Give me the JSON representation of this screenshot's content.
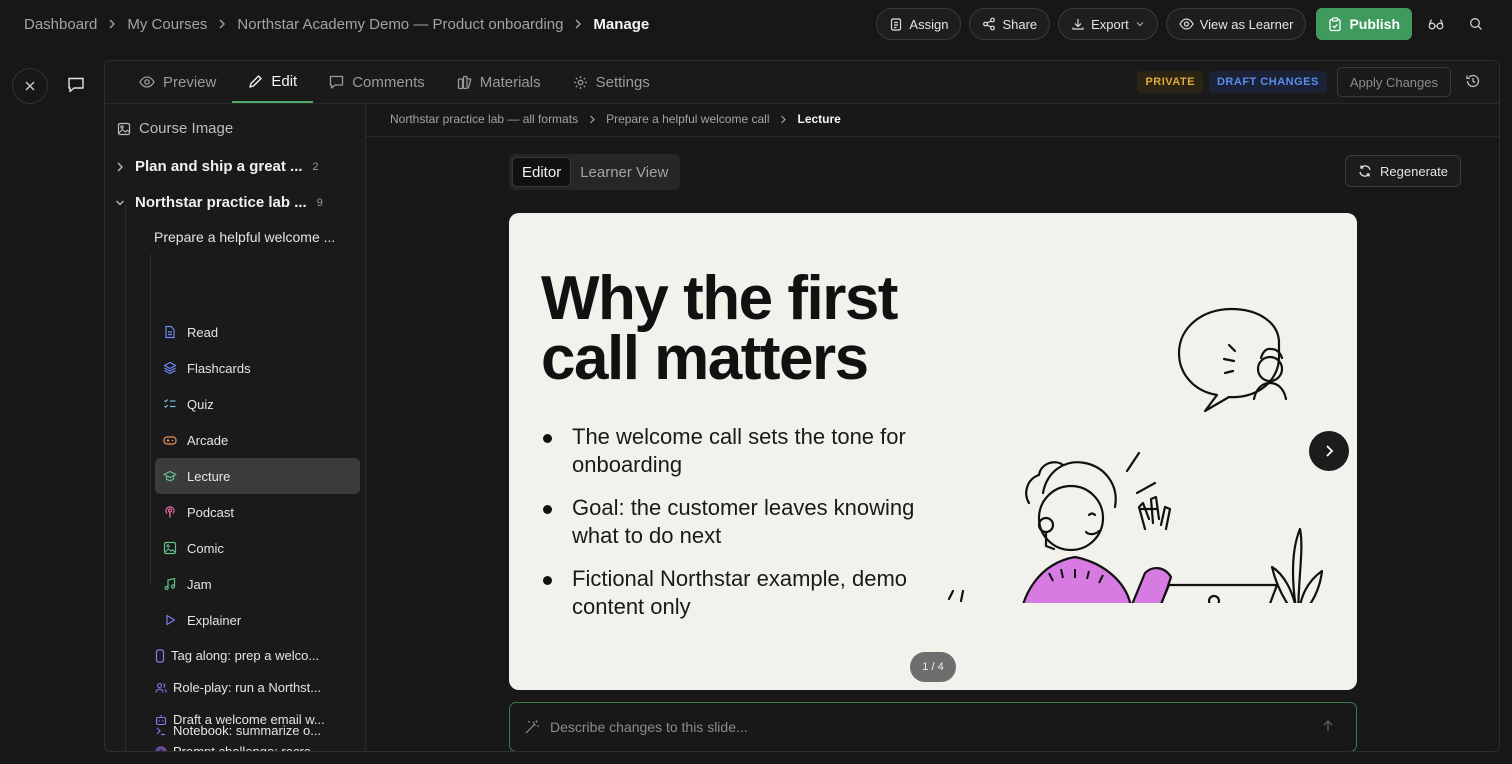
{
  "breadcrumb": {
    "items": [
      "Dashboard",
      "My Courses",
      "Northstar Academy Demo — Product onboarding"
    ],
    "current": "Manage"
  },
  "top_actions": {
    "assign": "Assign",
    "share": "Share",
    "export": "Export",
    "view_as_learner": "View as Learner",
    "publish": "Publish"
  },
  "tabs": [
    "Preview",
    "Edit",
    "Comments",
    "Materials",
    "Settings"
  ],
  "active_tab": "Edit",
  "status": {
    "private": "PRIVATE",
    "draft": "DRAFT CHANGES",
    "apply": "Apply Changes"
  },
  "sidebar": {
    "course_image": "Course Image",
    "sections": [
      {
        "title": "Plan and ship a great ...",
        "count": "2"
      },
      {
        "title": "Northstar practice lab ...",
        "count": "9"
      }
    ],
    "lesson": "Prepare a helpful welcome ...",
    "items": [
      "Read",
      "Flashcards",
      "Quiz",
      "Arcade",
      "Lecture",
      "Podcast",
      "Comic",
      "Jam",
      "Explainer"
    ],
    "active_item": "Lecture",
    "sub_lessons": [
      "Tag along: prep a welco...",
      "Role-play: run a Northst...",
      "Draft a welcome email w...",
      "Prompt challenge: recre...",
      "Notebook: summarize o..."
    ]
  },
  "content": {
    "crumbs": [
      "Northstar practice lab — all formats",
      "Prepare a helpful welcome call"
    ],
    "crumb_current": "Lecture",
    "view_toggle": [
      "Editor",
      "Learner View"
    ],
    "regenerate": "Regenerate",
    "slide": {
      "title": "Why the first call matters",
      "bullets": [
        "The welcome call sets the tone for onboarding",
        "Goal: the customer leaves knowing what to do next",
        "Fictional Northstar example, demo content only"
      ],
      "pager": "1 / 4"
    },
    "prompt_placeholder": "Describe changes to this slide..."
  },
  "colors": {
    "accent": "#3f9a5e",
    "private": "#e0a93a",
    "draft": "#5b8df0",
    "slide_bg": "#f3f1ec",
    "sweater": "#d77be3"
  }
}
